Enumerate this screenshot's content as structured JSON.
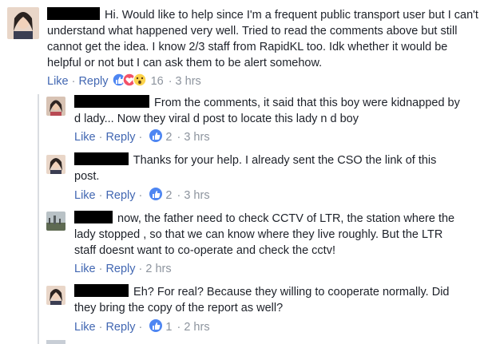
{
  "comments": [
    {
      "text": "Hi. Would like to help since I'm a frequent public transport user but I can't understand what happened very well. Tried to read the comments above but still cannot get the idea. I know 2/3 staff from RapidKL too. Idk whether it would be helpful or not but I can ask them to be alert somehow.",
      "like_label": "Like",
      "reply_label": "Reply",
      "reaction_count": "16",
      "timestamp": "3 hrs",
      "reactions": [
        "like-icon",
        "love-icon",
        "wow-icon"
      ]
    },
    {
      "text": "From the comments, it said that this boy were kidnapped by d lady... Now they viral d post to locate this lady n d boy",
      "like_label": "Like",
      "reply_label": "Reply",
      "reaction_count": "2",
      "timestamp": "3 hrs",
      "reactions": [
        "like-icon"
      ]
    },
    {
      "text": "Thanks for your help. I already sent the CSO the link of this post.",
      "like_label": "Like",
      "reply_label": "Reply",
      "reaction_count": "2",
      "timestamp": "3 hrs",
      "reactions": [
        "like-icon"
      ]
    },
    {
      "text": "now, the father need to check CCTV of LTR, the station where the lady stopped , so that we can know where they live roughly. But the LTR staff doesnt want to co-operate and check the cctv!",
      "like_label": "Like",
      "reply_label": "Reply",
      "timestamp": "2 hrs"
    },
    {
      "text": "Eh? For real? Because they willing to cooperate normally. Did they bring the copy of the report as well?",
      "like_label": "Like",
      "reply_label": "Reply",
      "reaction_count": "1",
      "timestamp": "2 hrs",
      "reactions": [
        "like-icon"
      ]
    }
  ],
  "colors": {
    "link": "#4267b2",
    "meta": "#8d949e",
    "text": "#1d2129",
    "like_blue": "#4e86f2",
    "love_red": "#f25268",
    "wow_yellow": "#fcd34b"
  }
}
